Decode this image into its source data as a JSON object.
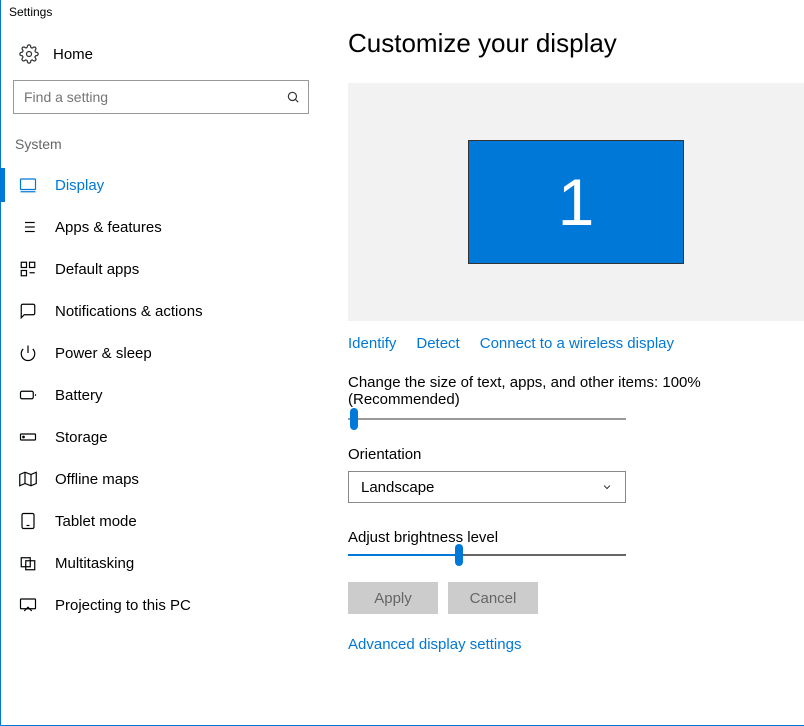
{
  "window_title": "Settings",
  "sidebar": {
    "home_label": "Home",
    "search_placeholder": "Find a setting",
    "group_label": "System",
    "items": [
      {
        "label": "Display",
        "active": true
      },
      {
        "label": "Apps & features"
      },
      {
        "label": "Default apps"
      },
      {
        "label": "Notifications & actions"
      },
      {
        "label": "Power & sleep"
      },
      {
        "label": "Battery"
      },
      {
        "label": "Storage"
      },
      {
        "label": "Offline maps"
      },
      {
        "label": "Tablet mode"
      },
      {
        "label": "Multitasking"
      },
      {
        "label": "Projecting to this PC"
      }
    ]
  },
  "main": {
    "title": "Customize your display",
    "monitor_number": "1",
    "links": {
      "identify": "Identify",
      "detect": "Detect",
      "connect": "Connect to a wireless display"
    },
    "scale_label": "Change the size of text, apps, and other items: 100% (Recommended)",
    "scale_slider_percent": 0,
    "orientation_label": "Orientation",
    "orientation_value": "Landscape",
    "brightness_label": "Adjust brightness level",
    "brightness_slider_percent": 40,
    "apply_label": "Apply",
    "cancel_label": "Cancel",
    "advanced_link": "Advanced display settings"
  }
}
